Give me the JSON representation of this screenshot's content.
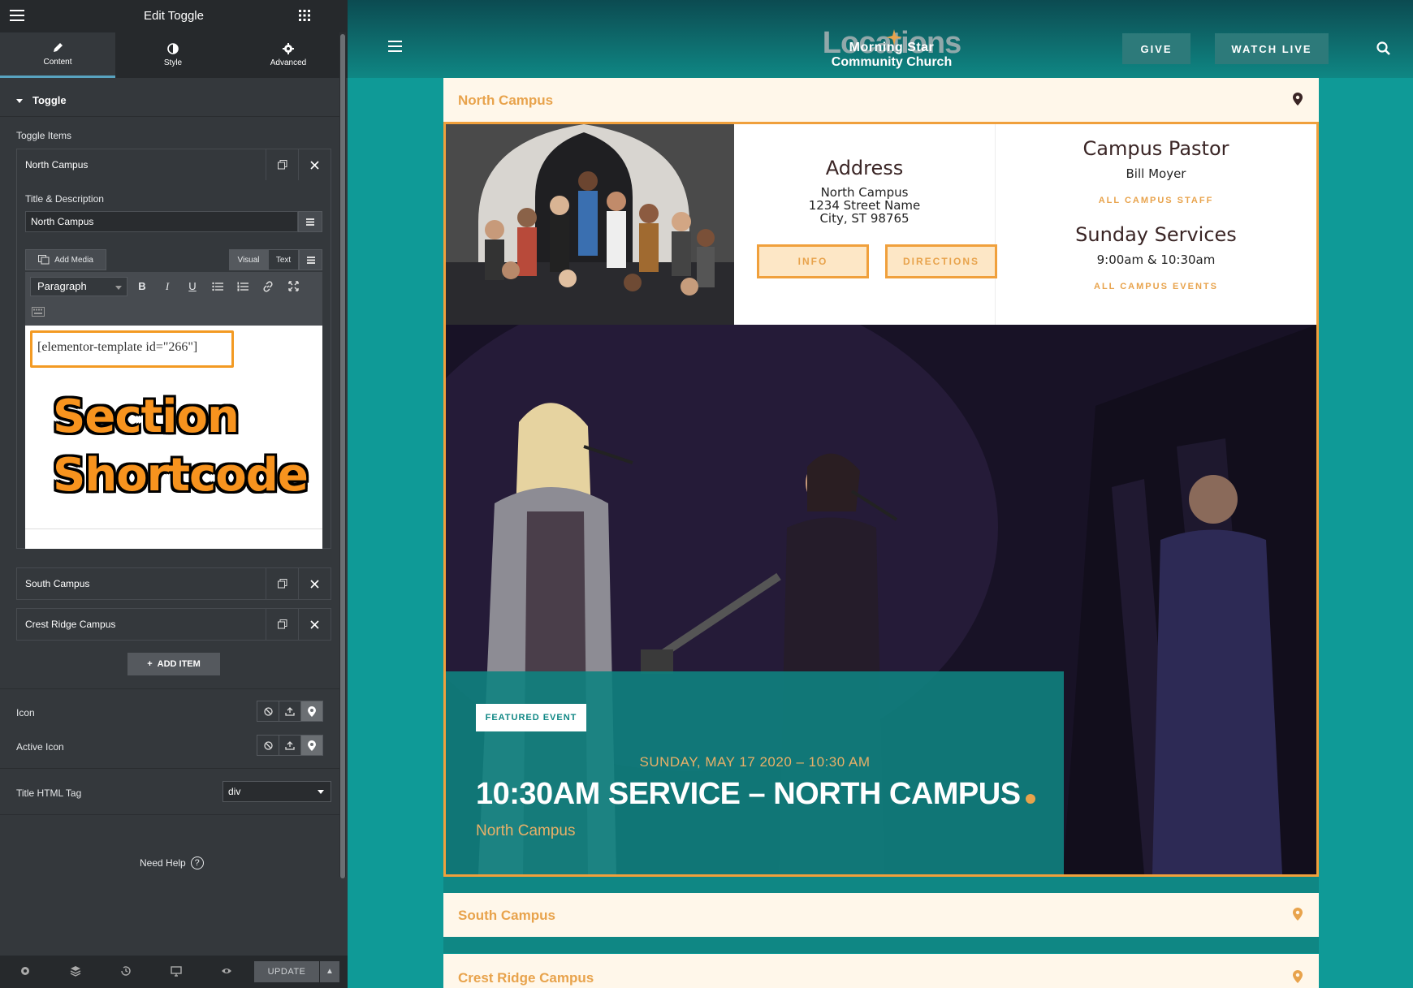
{
  "panel": {
    "title": "Edit Toggle",
    "tabs": [
      {
        "label": "Content",
        "icon": "pencil-icon"
      },
      {
        "label": "Style",
        "icon": "contrast-icon"
      },
      {
        "label": "Advanced",
        "icon": "gear-icon"
      }
    ],
    "section_title": "Toggle",
    "toggle_items_label": "Toggle Items",
    "items": [
      {
        "name": "North Campus"
      },
      {
        "name": "South Campus"
      },
      {
        "name": "Crest Ridge Campus"
      }
    ],
    "title_desc_label": "Title & Description",
    "title_value": "North Campus",
    "add_media_label": "Add Media",
    "visual_tab": "Visual",
    "text_tab": "Text",
    "format_select": "Paragraph",
    "shortcode": "[elementor-template id=\"266\"]",
    "overlay_line1": "Section",
    "overlay_line2": "Shortcode",
    "add_item_label": "ADD ITEM",
    "icon_label": "Icon",
    "active_icon_label": "Active Icon",
    "title_tag_label": "Title HTML Tag",
    "title_tag_value": "div",
    "need_help": "Need Help",
    "update_label": "UPDATE"
  },
  "site": {
    "logo_back": "Locations",
    "logo_line1": "Morning Star",
    "logo_line2": "Community Church",
    "give_label": "GIVE",
    "watch_label": "WATCH LIVE",
    "toggles": [
      "North Campus",
      "South Campus",
      "Crest Ridge Campus"
    ],
    "address": {
      "heading": "Address",
      "line1": "North Campus",
      "line2": "1234 Street Name",
      "line3": "City, ST 98765",
      "info_btn": "INFO",
      "directions_btn": "DIRECTIONS"
    },
    "pastor": {
      "heading": "Campus Pastor",
      "name": "Bill Moyer",
      "staff_link": "ALL CAMPUS STAFF",
      "services_heading": "Sunday Services",
      "times": "9:00am & 10:30am",
      "events_link": "ALL CAMPUS EVENTS"
    },
    "event": {
      "badge": "FEATURED EVENT",
      "date": "SUNDAY, MAY 17 2020 – 10:30 AM",
      "title": "10:30AM SERVICE – NORTH CAMPUS",
      "location": "North Campus"
    },
    "colors": {
      "teal": "#0f9a97",
      "orange": "#f0a03c",
      "cream": "#fff7ea"
    }
  }
}
